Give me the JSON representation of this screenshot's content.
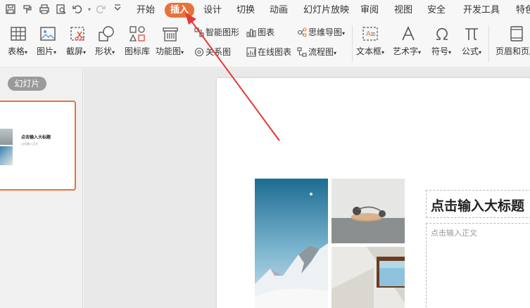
{
  "menubar": {
    "items": [
      "开始",
      "插入",
      "设计",
      "切换",
      "动画",
      "幻灯片放映",
      "审阅",
      "视图",
      "安全",
      "开发工具",
      "特色"
    ],
    "active_index": 1
  },
  "ribbon": {
    "large": [
      {
        "label": "表格",
        "icon": "table-icon",
        "dropdown": true
      },
      {
        "label": "图片",
        "icon": "picture-icon",
        "dropdown": true
      },
      {
        "label": "截屏",
        "icon": "screenshot-icon",
        "dropdown": true
      },
      {
        "label": "形状",
        "icon": "shapes-icon",
        "dropdown": true
      },
      {
        "label": "图标库",
        "icon": "icon-library-icon",
        "dropdown": false
      },
      {
        "label": "功能图",
        "icon": "function-chart-icon",
        "dropdown": true
      }
    ],
    "small": [
      {
        "label": "智能图形",
        "icon": "smartart-icon"
      },
      {
        "label": "图表",
        "icon": "chart-icon"
      },
      {
        "label": "思维导图",
        "icon": "mindmap-icon",
        "dropdown": true
      },
      {
        "label": "关系图",
        "icon": "relation-icon"
      },
      {
        "label": "在线图表",
        "icon": "online-chart-icon"
      },
      {
        "label": "流程图",
        "icon": "flowchart-icon",
        "dropdown": true
      }
    ],
    "large2": [
      {
        "label": "文本框",
        "icon": "textbox-icon",
        "dropdown": true
      },
      {
        "label": "艺术字",
        "icon": "wordart-icon",
        "dropdown": true
      },
      {
        "label": "符号",
        "icon": "omega-icon",
        "dropdown": true
      },
      {
        "label": "公式",
        "icon": "pi-icon",
        "dropdown": true
      },
      {
        "label": "页眉和页脚",
        "icon": "header-footer-icon",
        "dropdown": false
      }
    ]
  },
  "left_panel": {
    "tab_label": "幻灯片",
    "thumb_title": "点击输入大标题",
    "thumb_body": "点击输入正文"
  },
  "slide": {
    "title_placeholder": "点击输入大标题",
    "body_placeholder": "点击输入正文"
  },
  "colors": {
    "accent": "#e8713a",
    "arrow": "#e53935"
  }
}
